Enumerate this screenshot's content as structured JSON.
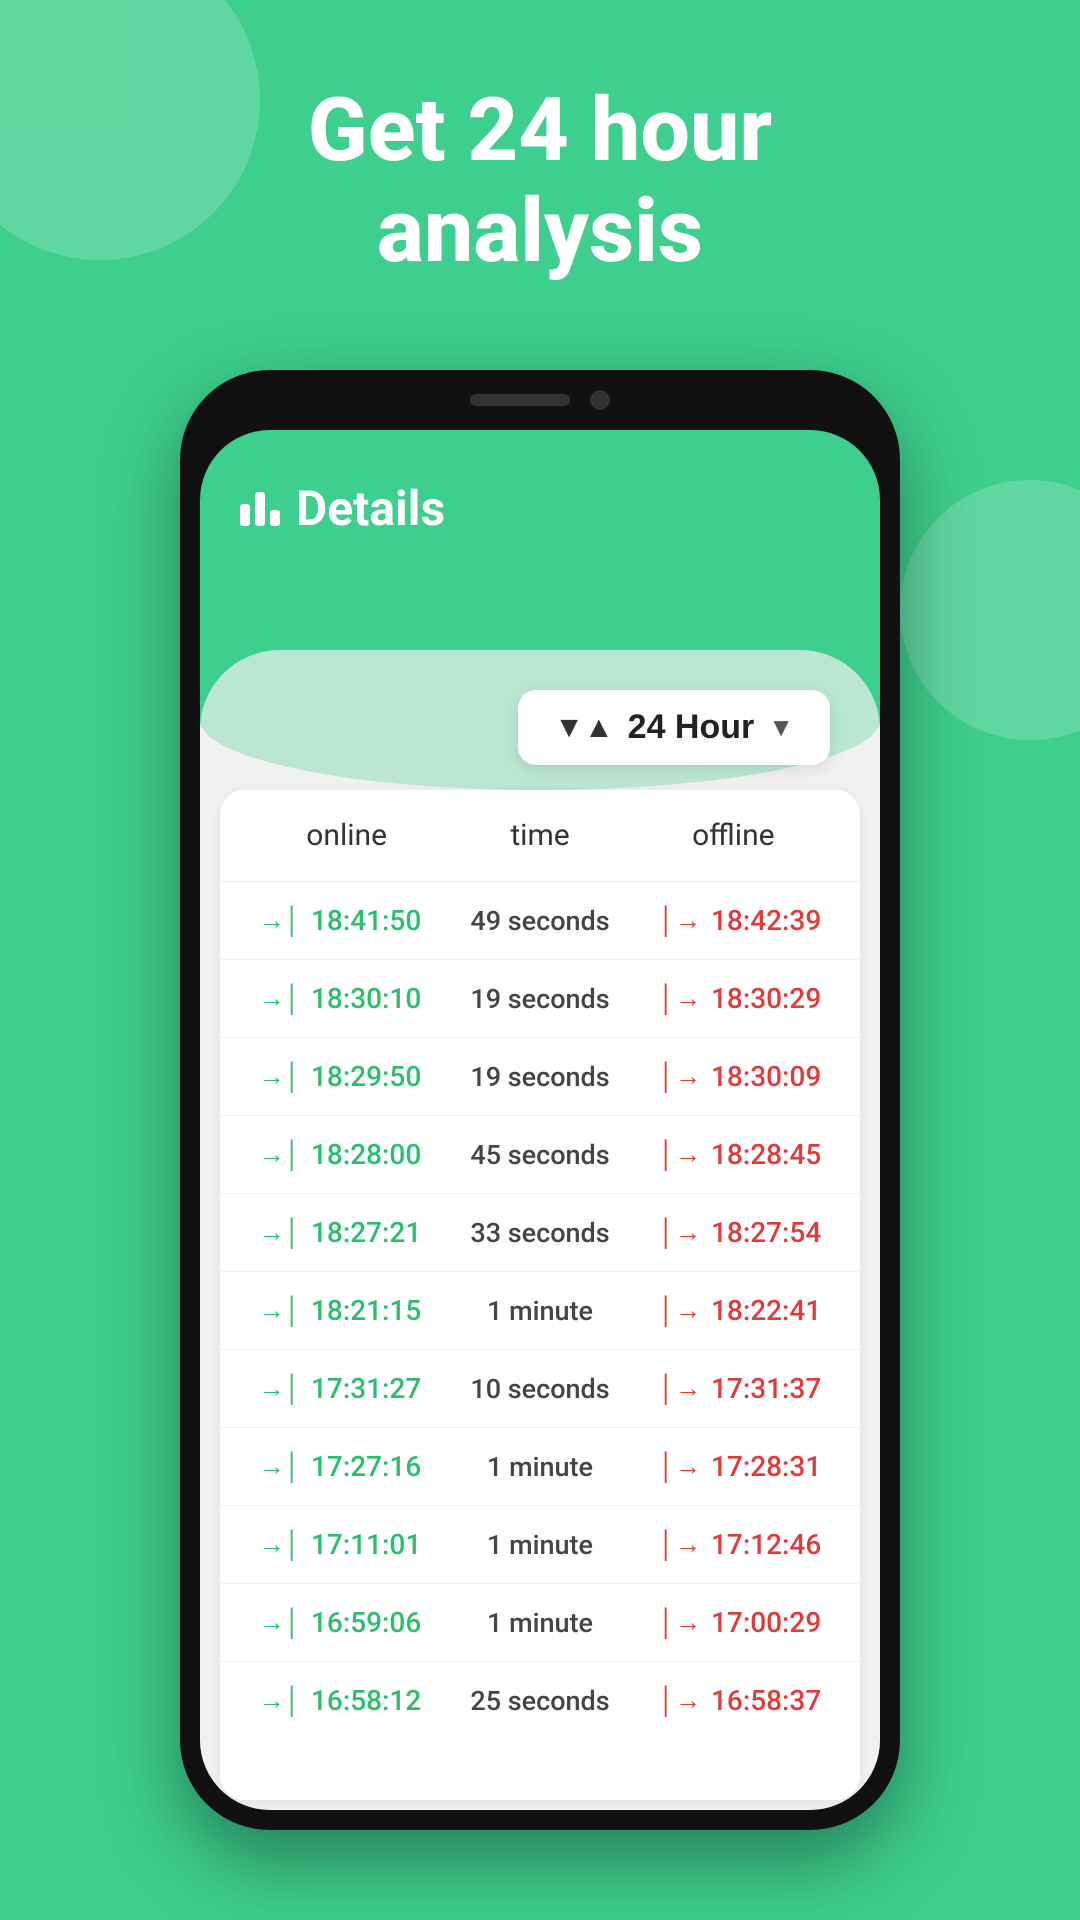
{
  "background_color": "#3ecf8e",
  "header": {
    "line1": "Get 24 hour",
    "line2": "analysis"
  },
  "app": {
    "title": "Details",
    "bar_icon": "bar-chart-icon"
  },
  "filter": {
    "label": "24 Hour",
    "icon": "filter-icon",
    "chevron": "chevron-down-icon"
  },
  "table": {
    "columns": [
      "online",
      "time",
      "offline"
    ],
    "rows": [
      {
        "online": "18:41:50",
        "time": "49 seconds",
        "offline": "18:42:39"
      },
      {
        "online": "18:30:10",
        "time": "19 seconds",
        "offline": "18:30:29"
      },
      {
        "online": "18:29:50",
        "time": "19 seconds",
        "offline": "18:30:09"
      },
      {
        "online": "18:28:00",
        "time": "45 seconds",
        "offline": "18:28:45"
      },
      {
        "online": "18:27:21",
        "time": "33 seconds",
        "offline": "18:27:54"
      },
      {
        "online": "18:21:15",
        "time": "1 minute",
        "offline": "18:22:41"
      },
      {
        "online": "17:31:27",
        "time": "10 seconds",
        "offline": "17:31:37"
      },
      {
        "online": "17:27:16",
        "time": "1 minute",
        "offline": "17:28:31"
      },
      {
        "online": "17:11:01",
        "time": "1 minute",
        "offline": "17:12:46"
      },
      {
        "online": "16:59:06",
        "time": "1 minute",
        "offline": "17:00:29"
      },
      {
        "online": "16:58:12",
        "time": "25 seconds",
        "offline": "16:58:37"
      }
    ]
  }
}
